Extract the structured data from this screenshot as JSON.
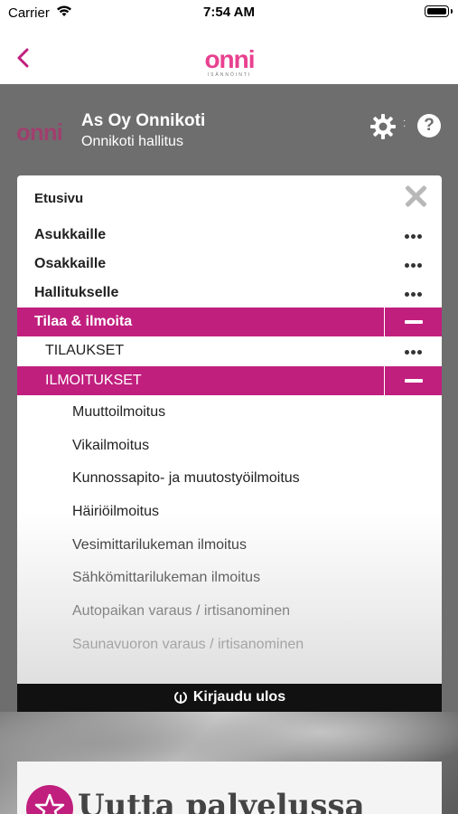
{
  "status_bar": {
    "carrier": "Carrier",
    "time": "7:54 AM"
  },
  "nav": {
    "logo_word": "onni",
    "logo_sub": "ISÄNNÖINTI"
  },
  "header": {
    "logo_word": "onni",
    "title": "As Oy Onnikoti",
    "subtitle": "Onnikoti hallitus",
    "help_label": "?"
  },
  "menu": {
    "home": "Etusivu",
    "items": [
      {
        "label": "Asukkaille"
      },
      {
        "label": "Osakkaille"
      },
      {
        "label": "Hallitukselle"
      },
      {
        "label": "Tilaa & ilmoita"
      }
    ],
    "subsections": [
      {
        "label": "TILAUKSET"
      },
      {
        "label": "ILMOITUKSET"
      }
    ],
    "ilmoitukset_items": [
      "Muuttoilmoitus",
      "Vikailmoitus",
      "Kunnossapito- ja muutostyöilmoitus",
      "Häiriöilmoitus",
      "Vesimittarilukeman ilmoitus",
      "Sähkömittarilukeman ilmoitus",
      "Autopaikan varaus / irtisanominen",
      "Saunavuoron varaus / irtisanominen"
    ],
    "logout": "Kirjaudu ulos"
  },
  "background": {
    "news_title": "Uutta palvelussa"
  },
  "colors": {
    "accent": "#c01f7e",
    "brand_pink": "#e8418f",
    "overlay": "#6e6e6e"
  }
}
